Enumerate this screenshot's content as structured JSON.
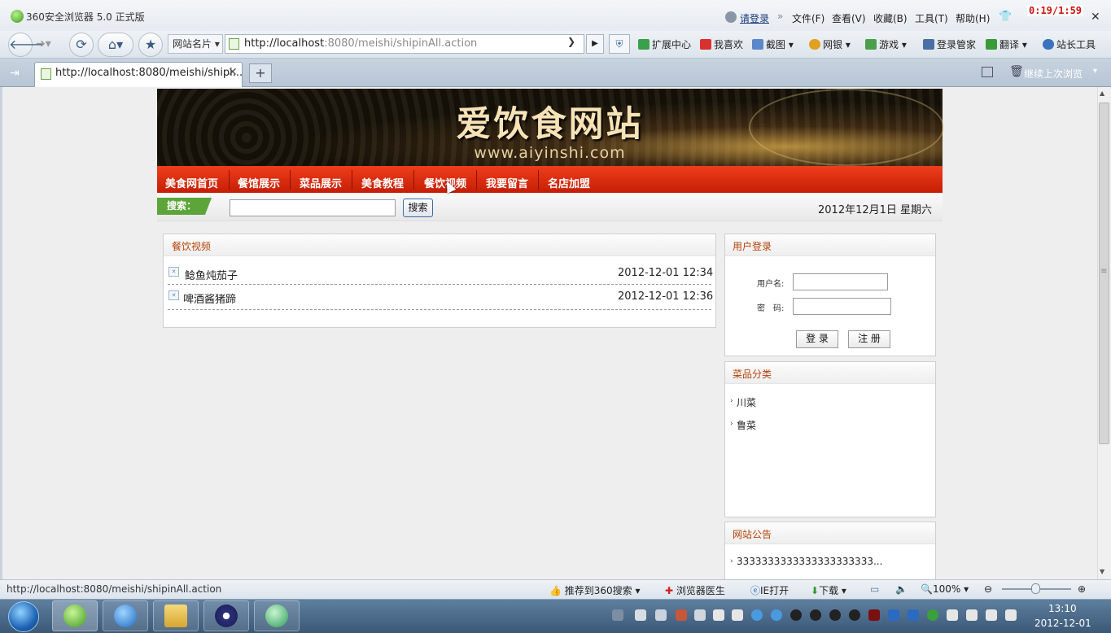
{
  "window": {
    "title": "360安全浏览器 5.0 正式版",
    "login_link": "请登录",
    "menus": [
      "文件(F)",
      "查看(V)",
      "收藏(B)",
      "工具(T)",
      "帮助(H)"
    ],
    "timer": "0:19/1:59"
  },
  "toolbar": {
    "site_card": "网站名片",
    "address_host": "http://localhost",
    "address_rest": ":8080/meishi/shipinAll.action",
    "items": [
      "扩展中心",
      "我喜欢",
      "截图",
      "网银",
      "游戏",
      "登录管家",
      "翻译",
      "站长工具"
    ]
  },
  "tabs": {
    "active_title": "http://localhost:8080/meishi/shipi...",
    "continue_label": "继续上次浏览"
  },
  "site": {
    "name": "爱饮食网站",
    "url": "www.aiyinshi.com",
    "nav": [
      "美食网首页",
      "餐馆展示",
      "菜品展示",
      "美食教程",
      "餐饮视频",
      "我要留言",
      "名店加盟"
    ],
    "search_label": "搜索：",
    "search_button": "搜索",
    "search_value": "",
    "date": "2012年12月1日 星期六"
  },
  "main": {
    "title": "餐饮视频",
    "rows": [
      {
        "title": "鲶鱼炖茄子",
        "date": "2012-12-01 12:34"
      },
      {
        "title": "啤酒酱猪蹄",
        "date": "2012-12-01 12:36"
      }
    ]
  },
  "login": {
    "title": "用户登录",
    "username_label": "用户名:",
    "password_label": "密　码:",
    "login_button": "登 录",
    "register_button": "注 册"
  },
  "categories": {
    "title": "菜品分类",
    "items": [
      "川菜",
      "鲁菜"
    ]
  },
  "notice": {
    "title": "网站公告",
    "text": "3333333333333333333333..."
  },
  "statusbar": {
    "url": "http://localhost:8080/meishi/shipinAll.action",
    "recommend": "推荐到360搜索",
    "doctor": "浏览器医生",
    "ie_open": "IE打开",
    "download": "下载",
    "zoom": "100%"
  },
  "taskbar": {
    "time": "13:10",
    "date": "2012-12-01"
  },
  "colors": {
    "nav_red": "#d62a0e",
    "panel_title": "#b4420a",
    "search_green": "#5da43a"
  }
}
